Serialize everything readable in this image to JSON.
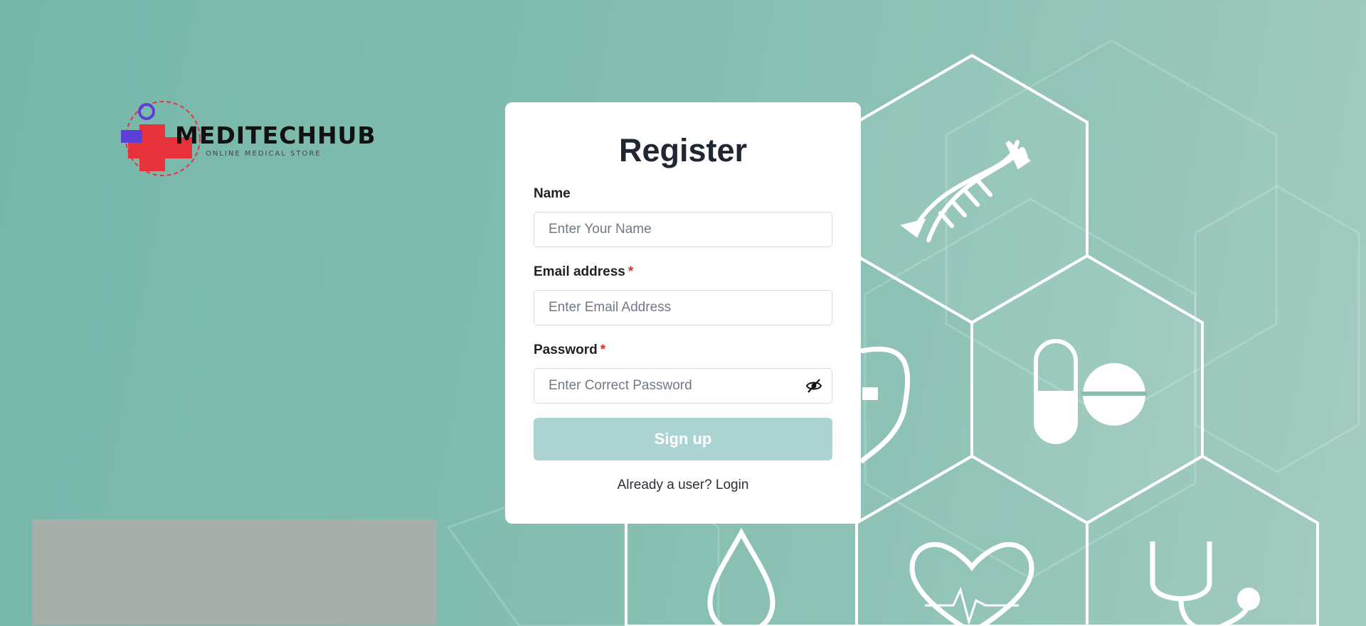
{
  "brand": {
    "name": "MEDITECHHUB",
    "tagline": "ONLINE MEDICAL STORE"
  },
  "form": {
    "title": "Register",
    "name": {
      "label": "Name",
      "placeholder": "Enter Your Name",
      "value": ""
    },
    "email": {
      "label": "Email address",
      "required_mark": "*",
      "placeholder": "Enter Email Address",
      "value": ""
    },
    "password": {
      "label": "Password",
      "required_mark": "*",
      "placeholder": "Enter Correct Password",
      "value": "",
      "toggle_icon": "eye-slash-icon"
    },
    "submit_label": "Sign up",
    "login_prompt": "Already a user?",
    "login_link": "Login"
  },
  "background_icons": [
    "dna-icon",
    "shield-icon",
    "pills-icon",
    "drop-icon",
    "heartbeat-icon",
    "stethoscope-icon"
  ],
  "colors": {
    "background": "#7fbcaf",
    "card": "#ffffff",
    "button_disabled": "#acd4d2",
    "required": "#d93025",
    "logo_red": "#e8323b",
    "logo_purple": "#5b3fd6"
  }
}
